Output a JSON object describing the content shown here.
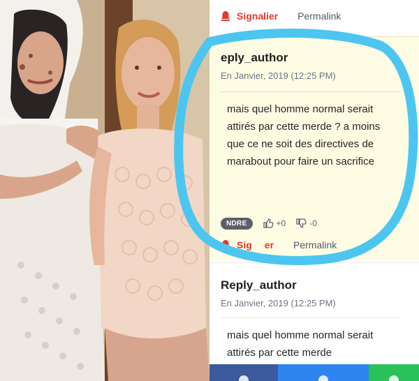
{
  "colors": {
    "report_red": "#e23a2c",
    "highlight_bg": "#fffce4",
    "annotation_blue": "#4cc6f0",
    "facebook": "#3b5b9e",
    "messenger": "#2f85f0",
    "whatsapp": "#29c25a"
  },
  "top_actions": {
    "report_label": "Signalier",
    "permalink_label": "Permalink",
    "icon": "bell-icon"
  },
  "highlighted_comment": {
    "author": "eply_author",
    "date": "En Janvier, 2019 (12:25 PM)",
    "body": "mais quel homme normal serait attirés par cette merde ? a moins que ce ne soit des directives de marabout pour faire un sacrifice",
    "reply_label": "NDRE",
    "upvotes": "+0",
    "downvotes": "-0",
    "report_label": "Sig",
    "report_label_tail": "er",
    "permalink_label": "Permalink"
  },
  "second_comment": {
    "author": "Reply_author",
    "date": "En Janvier, 2019 (12:25 PM)",
    "body": "mais quel homme normal serait attirés par cette merde"
  },
  "share_bar": {
    "buttons": [
      "facebook",
      "messenger",
      "whatsapp"
    ]
  }
}
